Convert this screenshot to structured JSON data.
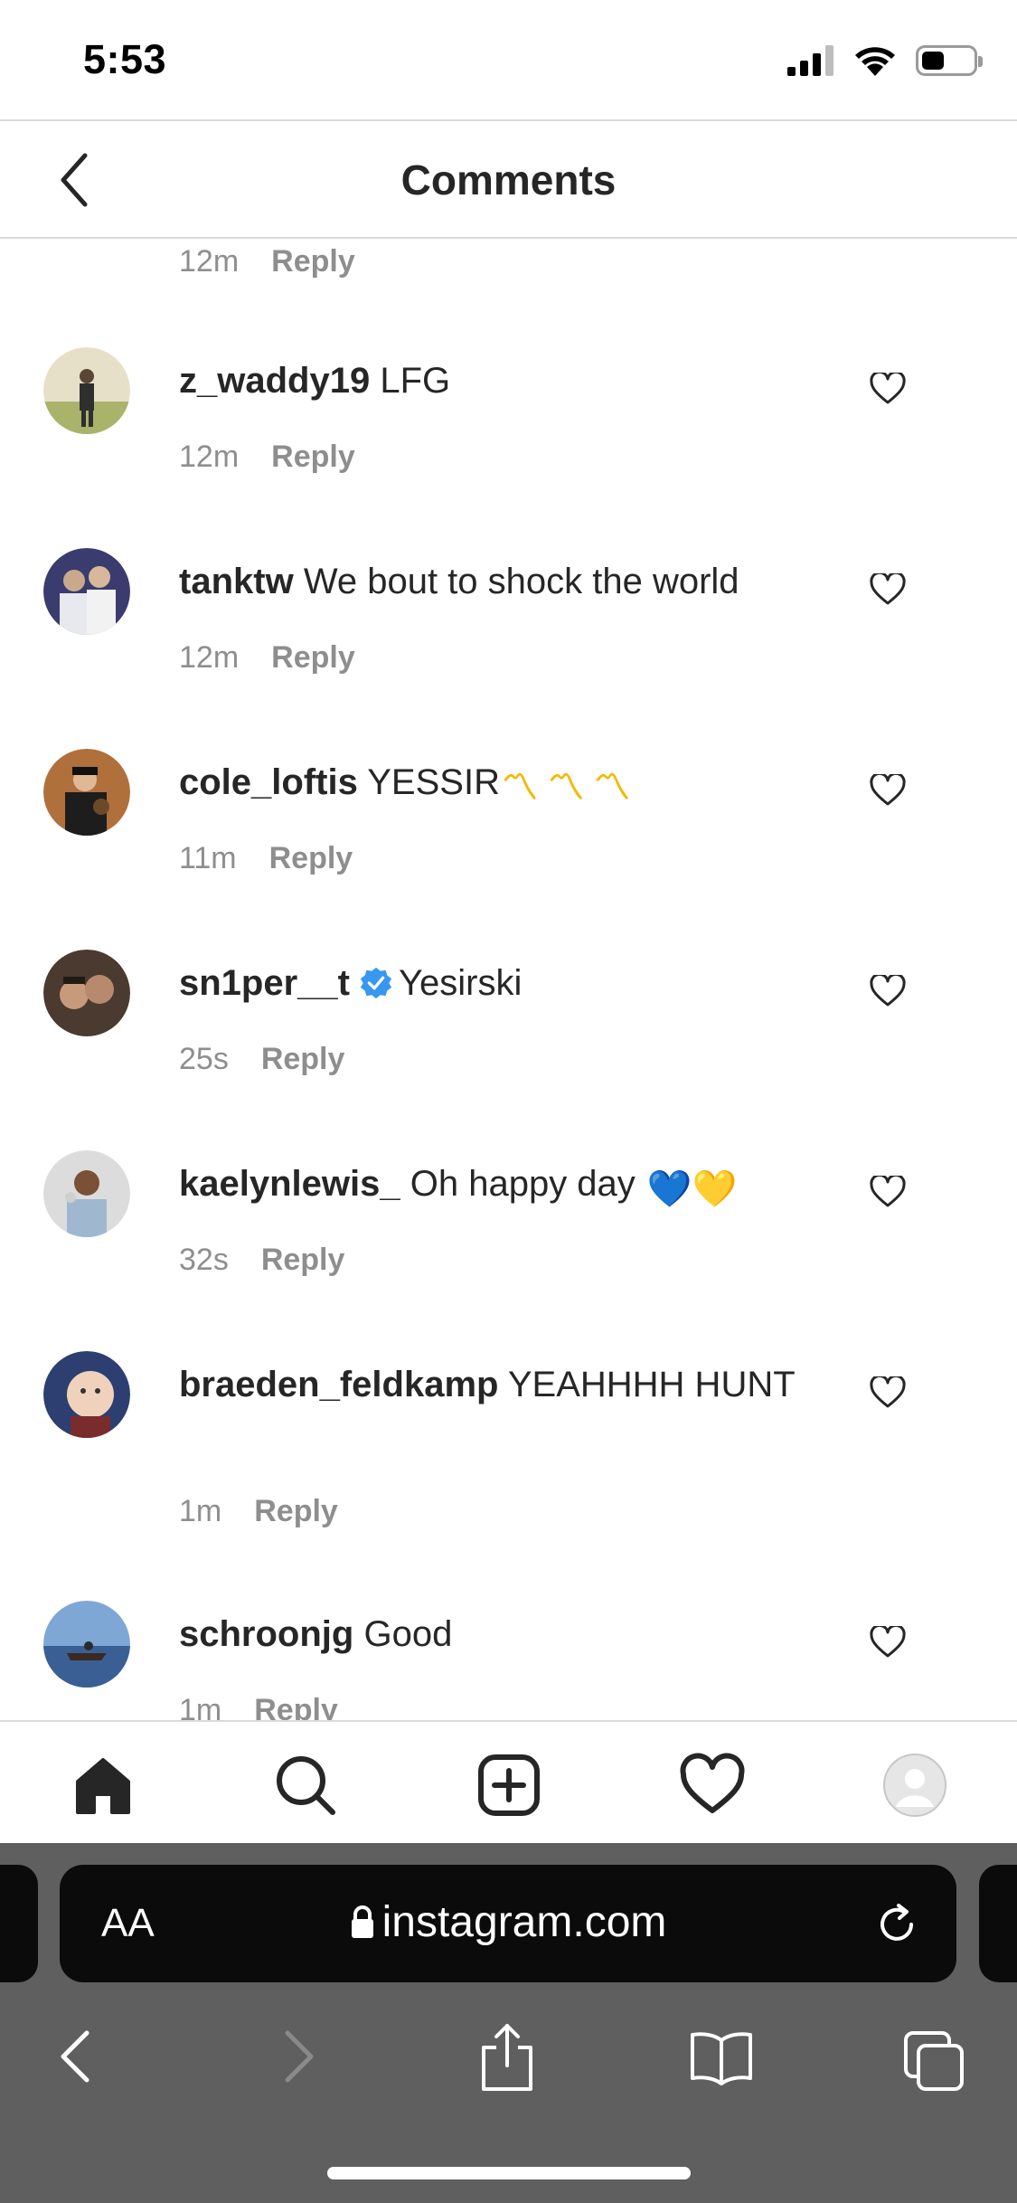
{
  "status_bar": {
    "time": "5:53",
    "battery_level": 0.45
  },
  "header": {
    "title": "Comments"
  },
  "comments": [
    {
      "time": "12m",
      "reply": "Reply"
    },
    {
      "username": "z_waddy19",
      "text": "LFG",
      "time": "12m",
      "reply": "Reply"
    },
    {
      "username": "tanktw",
      "text": "We bout to shock the world",
      "time": "12m",
      "reply": "Reply"
    },
    {
      "username": "cole_loftis",
      "text": "YESSIR",
      "emoji": "〽 〽 〽",
      "time": "11m",
      "reply": "Reply"
    },
    {
      "username": "sn1per__t",
      "verified": true,
      "text": "Yesirski",
      "time": "25s",
      "reply": "Reply"
    },
    {
      "username": "kaelynlewis_",
      "text": "Oh happy day",
      "emoji": "💙💛",
      "time": "32s",
      "reply": "Reply"
    },
    {
      "username": "braeden_feldkamp",
      "text": "YEAHHHH HUNT",
      "time": "1m",
      "reply": "Reply"
    },
    {
      "username": "schroonjg",
      "text": "Good",
      "time": "1m",
      "reply": "Reply"
    }
  ],
  "tabbar": {
    "items": [
      "home-icon",
      "search-icon",
      "new-post-icon",
      "activity-heart-icon",
      "profile-avatar-icon"
    ]
  },
  "safari": {
    "text_size_label": "AA",
    "url": "instagram.com"
  },
  "colors": {
    "text": "#262626",
    "secondary": "#8e8e8e",
    "divider": "#dbdbdb",
    "verified_blue": "#3897f0",
    "safari_bg": "#5f5f5f"
  }
}
